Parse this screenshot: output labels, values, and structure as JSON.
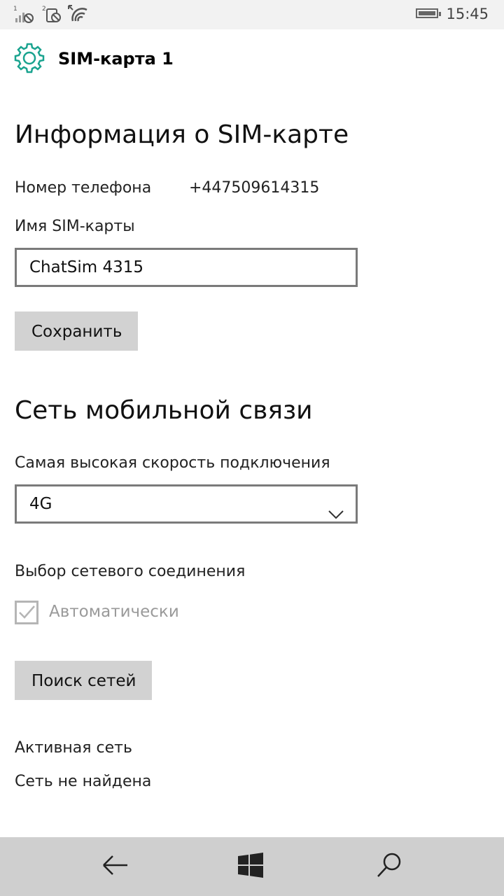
{
  "status_bar": {
    "time": "15:45",
    "sim1_badge": "1",
    "sim2_badge": "2",
    "icons": [
      "signal-sim1-icon",
      "signal-sim2-icon",
      "wifi-icon",
      "battery-icon"
    ]
  },
  "header": {
    "title": "SIM-карта 1",
    "icon": "gear-icon"
  },
  "sim_info": {
    "heading": "Информация о SIM-карте",
    "phone_label": "Номер телефона",
    "phone_value": "+447509614315",
    "name_label": "Имя SIM-карты",
    "name_value": "ChatSim 4315",
    "save_label": "Сохранить"
  },
  "mobile_network": {
    "heading": "Сеть мобильной связи",
    "speed_label": "Самая высокая скорость подключения",
    "speed_value": "4G",
    "selection_label": "Выбор сетевого соединения",
    "auto_label": "Автоматически",
    "auto_checked": true,
    "search_label": "Поиск сетей",
    "active_network_label": "Активная сеть",
    "active_network_value": "Сеть не найдена"
  },
  "nav_bar": {
    "icons": [
      "back-arrow-icon",
      "windows-start-icon",
      "search-icon"
    ]
  },
  "colors": {
    "accent": "#1aa38f",
    "button_bg": "#d2d2d2",
    "nav_bg": "#cfcfcf",
    "status_bg": "#f2f2f2"
  }
}
